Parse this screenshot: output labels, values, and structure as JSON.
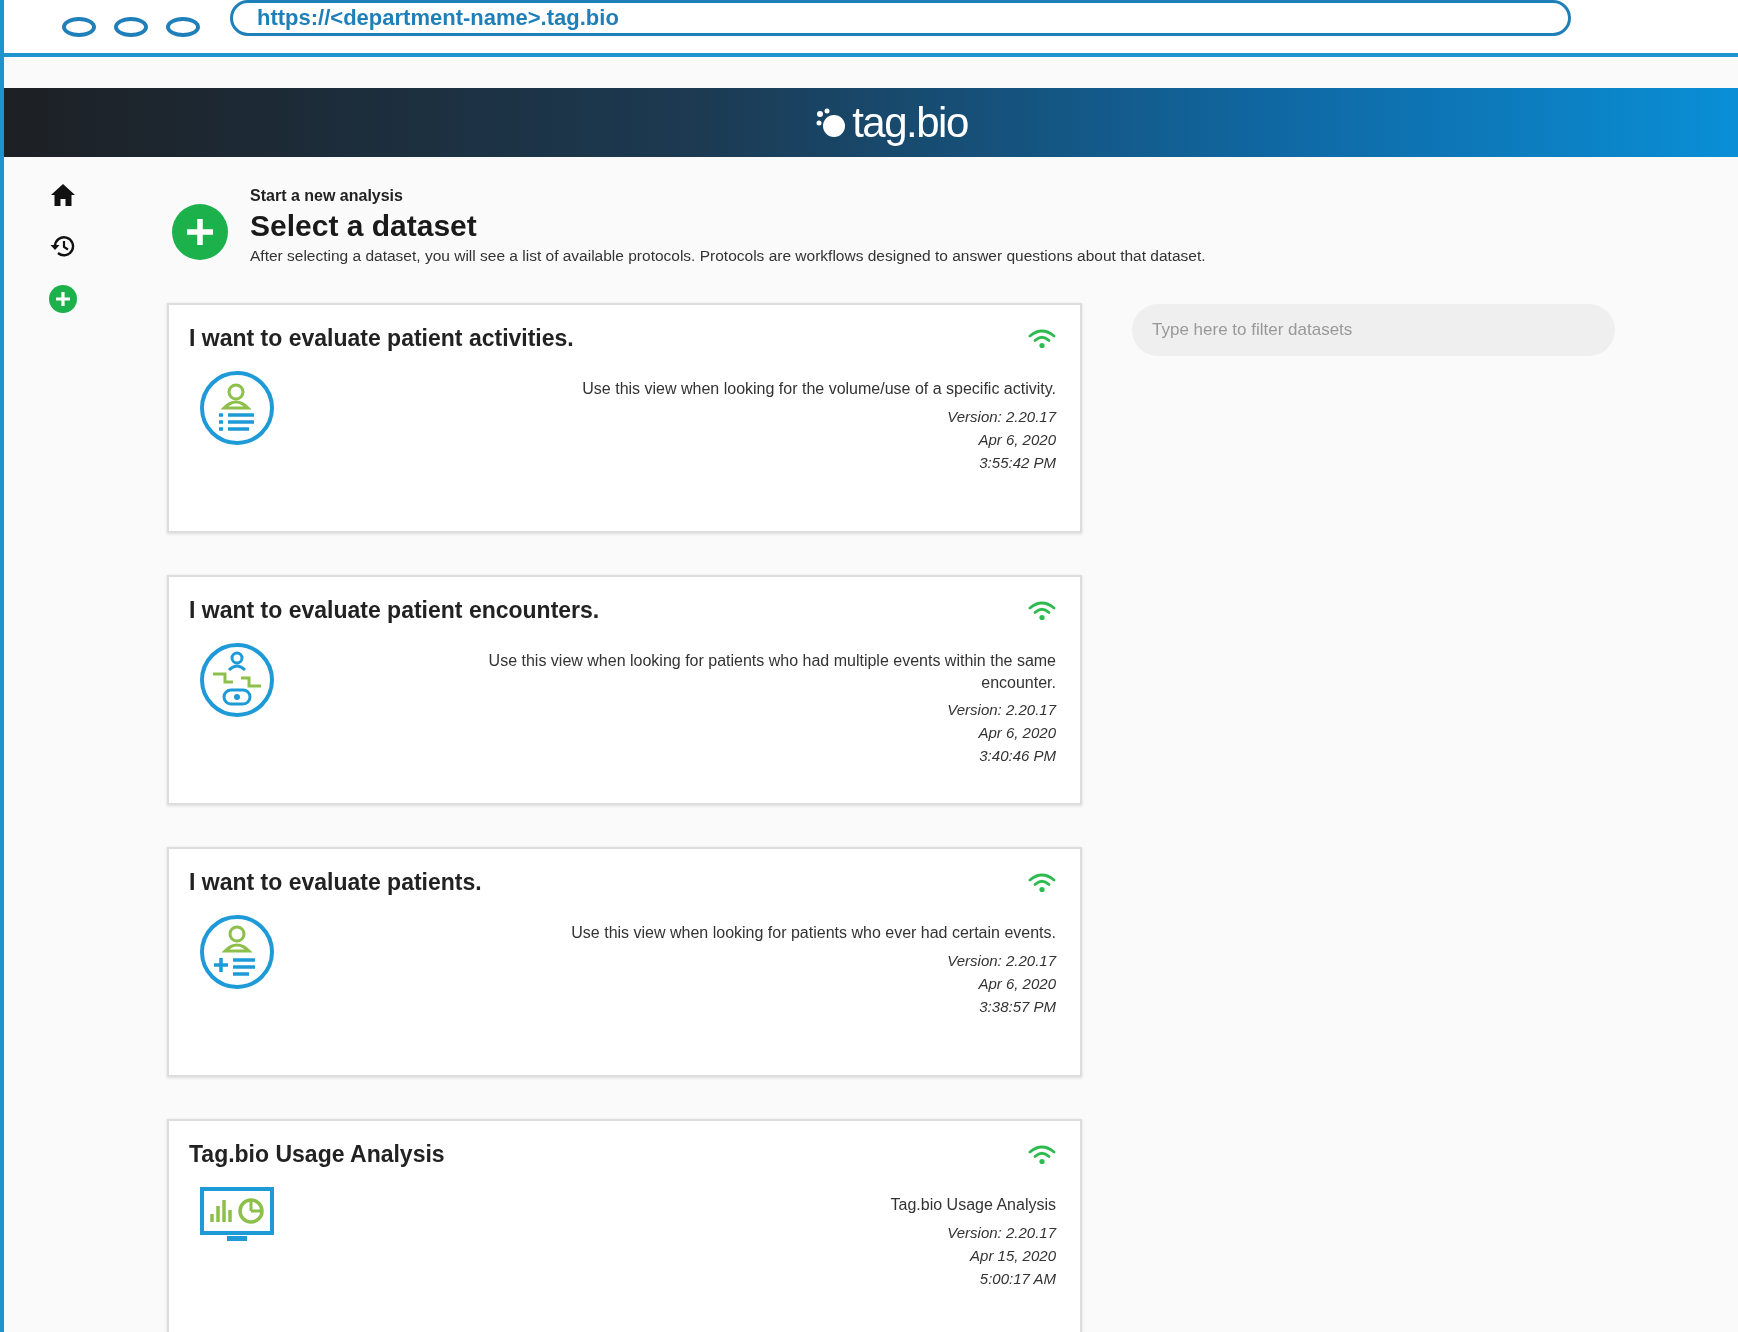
{
  "browser": {
    "url": "https://<department-name>.tag.bio"
  },
  "header": {
    "logo": "tag.bio"
  },
  "sidebar": {
    "items": [
      {
        "kind": "home"
      },
      {
        "kind": "history"
      },
      {
        "kind": "add"
      }
    ]
  },
  "intro": {
    "eyebrow": "Start a new analysis",
    "title": "Select a dataset",
    "description": "After selecting a dataset, you will see a list of available protocols. Protocols are workflows designed to answer questions about that dataset."
  },
  "filter": {
    "placeholder": "Type here to filter datasets"
  },
  "datasets": [
    {
      "kind": "activities",
      "title": "I want to evaluate patient activities.",
      "description": "Use this view when looking for the volume/use of a specific activity.",
      "version": "Version: 2.20.17",
      "date": "Apr 6, 2020",
      "time": "3:55:42 PM"
    },
    {
      "kind": "encounters",
      "title": "I want to evaluate patient encounters.",
      "description": "Use this view when looking for patients who had multiple events within the same encounter.",
      "version": "Version: 2.20.17",
      "date": "Apr 6, 2020",
      "time": "3:40:46 PM"
    },
    {
      "kind": "patients",
      "title": "I want to evaluate patients.",
      "description": "Use this view when looking for patients who ever had certain events.",
      "version": "Version: 2.20.17",
      "date": "Apr 6, 2020",
      "time": "3:38:57 PM"
    },
    {
      "kind": "usage",
      "title": "Tag.bio Usage Analysis",
      "description": "Tag.bio Usage Analysis",
      "version": "Version: 2.20.17",
      "date": "Apr 15, 2020",
      "time": "5:00:17 AM"
    }
  ]
}
